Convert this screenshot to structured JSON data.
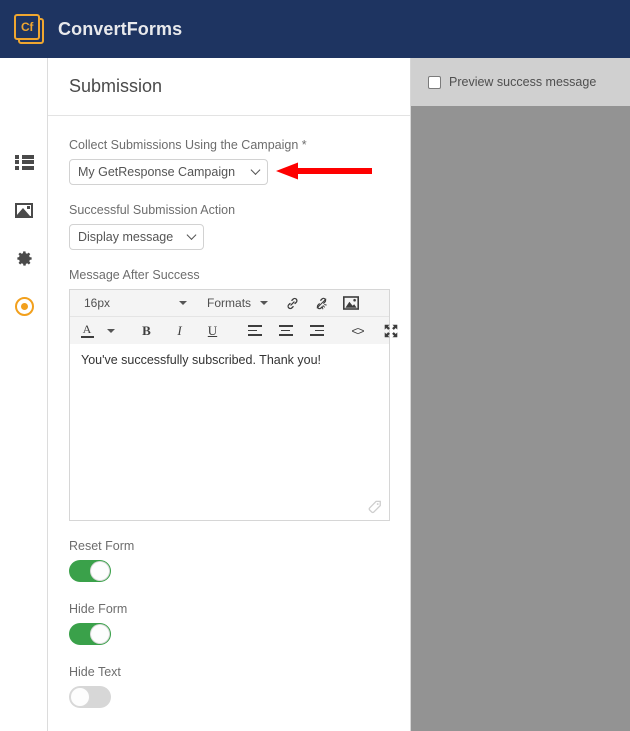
{
  "header": {
    "logo_text": "Cf",
    "logo_icon": "convertforms-logo-icon",
    "brand": "ConvertForms"
  },
  "sidebar": {
    "items": [
      {
        "icon": "list-icon",
        "name": "forms",
        "active": false
      },
      {
        "icon": "image-icon",
        "name": "media",
        "active": false
      },
      {
        "icon": "gear-icon",
        "name": "settings",
        "active": false
      },
      {
        "icon": "record-icon",
        "name": "submission",
        "active": true
      }
    ],
    "active_color": "#f2a01d"
  },
  "panel": {
    "title": "Submission",
    "campaign": {
      "label": "Collect Submissions Using the Campaign",
      "required_mark": "*",
      "value": "My GetResponse Campaign",
      "options": [
        "My GetResponse Campaign"
      ]
    },
    "action": {
      "label": "Successful Submission Action",
      "value": "Display message",
      "options": [
        "Display message"
      ]
    },
    "message": {
      "label": "Message After Success",
      "content": "You've successfully subscribed. Thank you!"
    },
    "editor_toolbar": {
      "font_size": "16px",
      "formats": "Formats",
      "buttons": [
        {
          "name": "link-icon",
          "label": "link"
        },
        {
          "name": "unlink-icon",
          "label": "unlink"
        },
        {
          "name": "insert-image-icon",
          "label": "image"
        },
        {
          "name": "text-color-icon",
          "label": "A"
        },
        {
          "name": "bold-icon",
          "label": "B"
        },
        {
          "name": "italic-icon",
          "label": "I"
        },
        {
          "name": "underline-icon",
          "label": "U"
        },
        {
          "name": "align-left-icon",
          "label": "align left"
        },
        {
          "name": "align-center-icon",
          "label": "align center"
        },
        {
          "name": "align-right-icon",
          "label": "align right"
        },
        {
          "name": "source-code-icon",
          "label": "<>"
        },
        {
          "name": "fullscreen-icon",
          "label": "fullscreen"
        }
      ]
    },
    "toggles": [
      {
        "label": "Reset Form",
        "state": "on"
      },
      {
        "label": "Hide Form",
        "state": "on"
      },
      {
        "label": "Hide Text",
        "state": "off"
      }
    ],
    "toggle_on_color": "#3aa14a",
    "toggle_off_color": "#d7d7d7"
  },
  "preview": {
    "checkbox_label": "Preview success message",
    "checked": false,
    "background": "#939393",
    "bar_background": "#d0d0d0"
  },
  "annotation": {
    "arrow_color": "#fe0000",
    "arrow_direction": "left",
    "points_at": "campaign-select"
  },
  "colors": {
    "topbar": "#1e3461",
    "accent": "#efa630"
  }
}
